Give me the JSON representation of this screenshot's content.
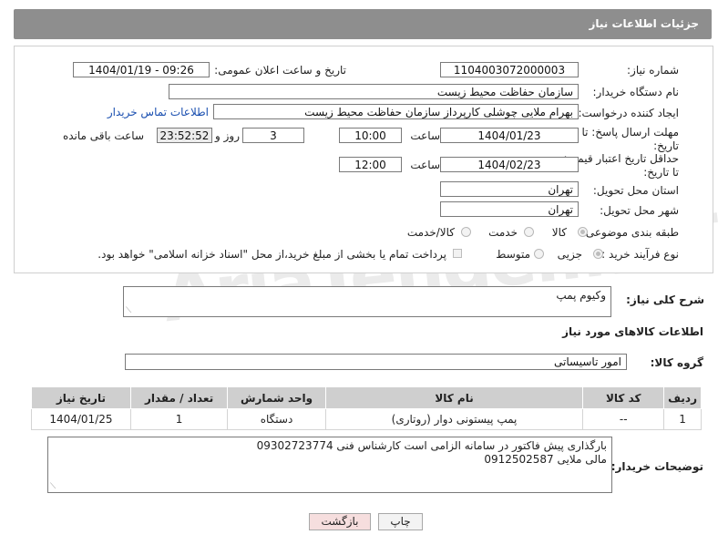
{
  "header": {
    "title": "جزئیات اطلاعات نیاز"
  },
  "form": {
    "need_number_label": "شماره نیاز:",
    "need_number": "1104003072000003",
    "announce_label": "تاریخ و ساعت اعلان عمومی:",
    "announce_value": "1404/01/19 - 09:26",
    "buyer_org_label": "نام دستگاه خریدار:",
    "buyer_org": "سازمان حفاظت محیط زیست",
    "creator_label": "ایجاد کننده درخواست:",
    "creator": "بهرام ملایی چوشلی کارپرداز سازمان حفاظت محیط زیست",
    "contact_link": "اطلاعات تماس خریدار",
    "reply_deadline_label": "مهلت ارسال پاسخ: تا تاریخ:",
    "reply_date": "1404/01/23",
    "time_label": "ساعت",
    "reply_time": "10:00",
    "days_value": "3",
    "days_label": "روز و",
    "remaining_time": "23:52:52",
    "remaining_label": "ساعت باقی مانده",
    "price_deadline_label": "حداقل تاریخ اعتبار قیمت: تا تاریخ:",
    "price_date": "1404/02/23",
    "price_time": "12:00",
    "province_label": "استان محل تحویل:",
    "province": "تهران",
    "city_label": "شهر محل تحویل:",
    "city": "تهران",
    "category_label": "طبقه بندی موضوعی:",
    "category_goods": "کالا",
    "category_service": "خدمت",
    "category_both": "کالا/خدمت",
    "process_label": "نوع فرآیند خرید :",
    "process_partial": "جزیی",
    "process_medium": "متوسط",
    "payment_note": "پرداخت تمام یا بخشی از مبلغ خرید،از محل \"اسناد خزانه اسلامی\" خواهد بود."
  },
  "summary": {
    "label": "شرح کلی نیاز:",
    "value": "وکیوم پمپ"
  },
  "goods_section": {
    "title": "اطلاعات کالاهای مورد نیاز",
    "group_label": "گروه کالا:",
    "group_value": "امور تاسیساتی"
  },
  "table": {
    "headers": [
      "ردیف",
      "کد کالا",
      "نام کالا",
      "واحد شمارش",
      "تعداد / مقدار",
      "تاریخ نیاز"
    ],
    "rows": [
      [
        "1",
        "--",
        "پمپ پیستونی دوار (روتاری)",
        "دستگاه",
        "1",
        "1404/01/25"
      ]
    ]
  },
  "notes": {
    "label": "توضیحات خریدار:",
    "line1": "بارگذاری پیش فاکتور در سامانه الزامی است کارشناس فنی 09302723774",
    "line2": "مالی ملایی 0912502587"
  },
  "buttons": {
    "print": "چاپ",
    "back": "بازگشت"
  },
  "watermark": "AriaTender.neT",
  "colors": {
    "title_bar": "#8e8e8e",
    "table_header": "#cfcfcf",
    "back_button": "#f6dede",
    "link": "#1a4fb0"
  }
}
